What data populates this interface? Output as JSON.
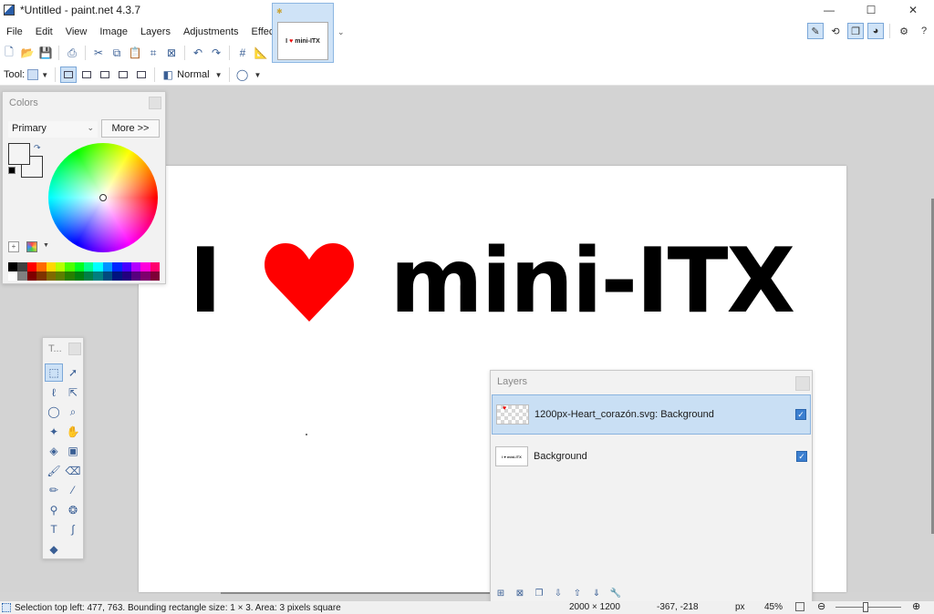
{
  "window": {
    "title": "*Untitled - paint.net 4.3.7",
    "minimize": "—",
    "maximize": "☐",
    "close": "✕"
  },
  "menu": [
    "File",
    "Edit",
    "View",
    "Image",
    "Layers",
    "Adjustments",
    "Effects"
  ],
  "image_tab": {
    "thumb_text_left": "I",
    "thumb_text_right": "mini-ITX"
  },
  "toolbar2": {
    "tool_label": "Tool:",
    "blend_mode": "Normal"
  },
  "canvas": {
    "text_left": "I",
    "text_right": "mini-ITX",
    "heart_color": "#ff0000"
  },
  "colors_panel": {
    "title": "Colors",
    "mode": "Primary",
    "more_button": "More >>",
    "palette": [
      "#000000",
      "#404040",
      "#ff0000",
      "#ff6a00",
      "#ffd800",
      "#b6ff00",
      "#4cff00",
      "#00ff21",
      "#00ff90",
      "#00ffff",
      "#0094ff",
      "#0026ff",
      "#4800ff",
      "#b200ff",
      "#ff00dc",
      "#ff006e",
      "#ffffff",
      "#808080",
      "#7f0000",
      "#7f3300",
      "#7f6a00",
      "#5b7f00",
      "#267f00",
      "#007f0e",
      "#007f46",
      "#007f7f",
      "#004a7f",
      "#00137f",
      "#21007f",
      "#57007f",
      "#7f006e",
      "#7f0037"
    ]
  },
  "tools_panel": {
    "title": "T..."
  },
  "layers_panel": {
    "title": "Layers",
    "layers": [
      {
        "name": "1200px-Heart_corazón.svg: Background",
        "visible": true,
        "selected": true
      },
      {
        "name": "Background",
        "visible": true,
        "selected": false
      }
    ]
  },
  "status": {
    "selection": "Selection top left: 477, 763. Bounding rectangle size: 1 × 3. Area: 3 pixels square",
    "image_size": "2000 × 1200",
    "cursor": "-367, -218",
    "unit": "px",
    "zoom": "45%"
  },
  "colors": {
    "accent": "#3b7fd0",
    "selection_bg": "#c9dff4"
  }
}
